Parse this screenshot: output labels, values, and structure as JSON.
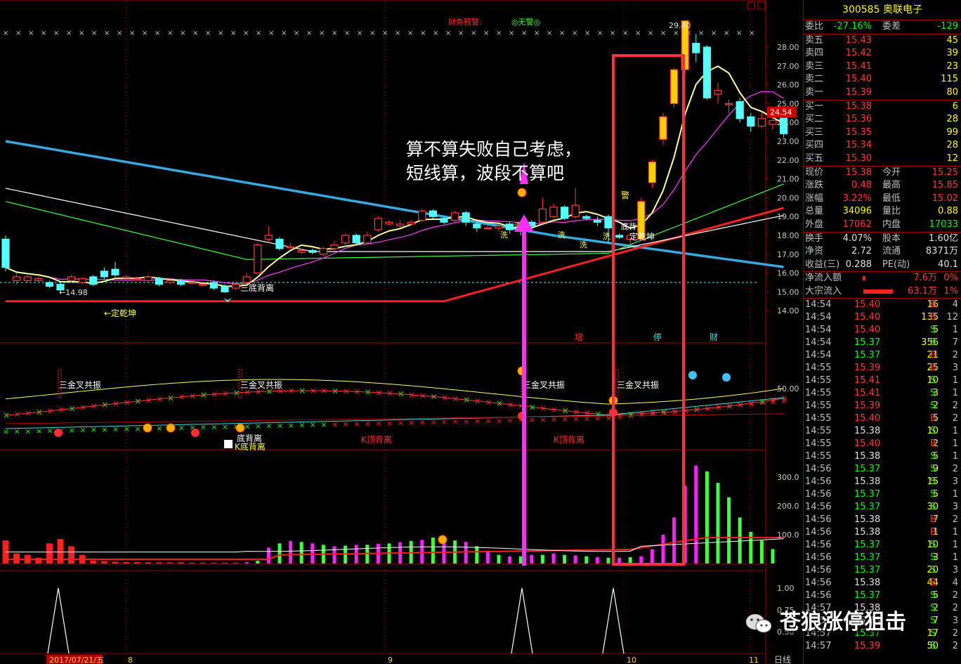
{
  "chart_data": {
    "type": "candlestick",
    "price_axis": {
      "ticks": [
        "28.00",
        "27.00",
        "26.00",
        "25.00",
        "24.00",
        "23.00",
        "22.00",
        "21.00",
        "20.00",
        "19.00",
        "18.00",
        "17.00",
        "16.00",
        "15.00",
        "14.00"
      ],
      "ylim": [
        14,
        29.4
      ]
    },
    "current_price_tag": "24.54",
    "high_label": "29.40",
    "low_label": "←14.98",
    "dashed_level": 15.5,
    "candles": [
      {
        "o": 17.8,
        "c": 16.3,
        "h": 18.0,
        "l": 16.1
      },
      {
        "o": 15.6,
        "c": 15.8,
        "h": 16.0,
        "l": 15.4
      },
      {
        "o": 15.6,
        "c": 15.8,
        "h": 15.9,
        "l": 15.5
      },
      {
        "o": 15.6,
        "c": 15.7,
        "h": 15.8,
        "l": 15.5
      },
      {
        "o": 15.5,
        "c": 15.3,
        "h": 15.6,
        "l": 15.2
      },
      {
        "o": 15.4,
        "c": 15.1,
        "h": 15.5,
        "l": 14.98
      },
      {
        "o": 15.6,
        "c": 15.8,
        "h": 15.9,
        "l": 15.5
      },
      {
        "o": 15.5,
        "c": 15.7,
        "h": 15.8,
        "l": 15.4
      },
      {
        "o": 15.8,
        "c": 15.4,
        "h": 15.9,
        "l": 15.3
      },
      {
        "o": 16.1,
        "c": 15.8,
        "h": 16.3,
        "l": 15.7
      },
      {
        "o": 16.2,
        "c": 15.9,
        "h": 16.6,
        "l": 15.8
      },
      {
        "o": 15.8,
        "c": 15.8,
        "h": 15.9,
        "l": 15.7
      },
      {
        "o": 15.7,
        "c": 15.7,
        "h": 15.8,
        "l": 15.6
      },
      {
        "o": 15.6,
        "c": 15.8,
        "h": 15.9,
        "l": 15.5
      },
      {
        "o": 15.7,
        "c": 15.4,
        "h": 15.8,
        "l": 15.3
      },
      {
        "o": 15.5,
        "c": 15.6,
        "h": 15.7,
        "l": 15.4
      },
      {
        "o": 15.6,
        "c": 15.4,
        "h": 15.7,
        "l": 15.3
      },
      {
        "o": 15.5,
        "c": 15.5,
        "h": 15.6,
        "l": 15.4
      },
      {
        "o": 15.4,
        "c": 15.4,
        "h": 15.5,
        "l": 15.3
      },
      {
        "o": 15.5,
        "c": 15.2,
        "h": 15.6,
        "l": 15.1
      },
      {
        "o": 15.3,
        "c": 15.0,
        "h": 15.4,
        "l": 14.95
      },
      {
        "o": 15.2,
        "c": 15.4,
        "h": 15.5,
        "l": 15.1
      },
      {
        "o": 15.5,
        "c": 15.8,
        "h": 16.0,
        "l": 15.4
      },
      {
        "o": 16.0,
        "c": 17.5,
        "h": 17.6,
        "l": 16.0
      },
      {
        "o": 17.8,
        "c": 18.0,
        "h": 18.5,
        "l": 17.6
      },
      {
        "o": 17.8,
        "c": 17.3,
        "h": 17.9,
        "l": 17.2
      },
      {
        "o": 17.4,
        "c": 17.4,
        "h": 17.6,
        "l": 17.3
      },
      {
        "o": 17.1,
        "c": 17.2,
        "h": 17.3,
        "l": 17.0
      },
      {
        "o": 17.2,
        "c": 17.1,
        "h": 17.3,
        "l": 17.0
      },
      {
        "o": 17.0,
        "c": 17.3,
        "h": 17.4,
        "l": 16.9
      },
      {
        "o": 17.3,
        "c": 17.5,
        "h": 17.7,
        "l": 17.2
      },
      {
        "o": 17.6,
        "c": 18.0,
        "h": 18.1,
        "l": 17.4
      },
      {
        "o": 18.0,
        "c": 17.6,
        "h": 18.1,
        "l": 17.5
      },
      {
        "o": 17.6,
        "c": 18.0,
        "h": 18.2,
        "l": 17.5
      },
      {
        "o": 18.3,
        "c": 18.9,
        "h": 19.0,
        "l": 18.2
      },
      {
        "o": 18.6,
        "c": 18.7,
        "h": 18.8,
        "l": 18.5
      },
      {
        "o": 18.5,
        "c": 18.6,
        "h": 18.8,
        "l": 18.4
      },
      {
        "o": 18.6,
        "c": 18.7,
        "h": 18.8,
        "l": 18.5
      },
      {
        "o": 18.8,
        "c": 19.3,
        "h": 19.4,
        "l": 18.7
      },
      {
        "o": 19.3,
        "c": 19.0,
        "h": 19.4,
        "l": 18.9
      },
      {
        "o": 18.9,
        "c": 18.7,
        "h": 19.0,
        "l": 18.6
      },
      {
        "o": 18.8,
        "c": 19.2,
        "h": 19.3,
        "l": 18.7
      },
      {
        "o": 19.2,
        "c": 18.7,
        "h": 19.3,
        "l": 18.5
      },
      {
        "o": 18.6,
        "c": 18.4,
        "h": 18.7,
        "l": 18.2
      },
      {
        "o": 18.4,
        "c": 18.4,
        "h": 18.5,
        "l": 18.3
      },
      {
        "o": 18.4,
        "c": 18.5,
        "h": 18.6,
        "l": 18.2
      },
      {
        "o": 18.6,
        "c": 18.3,
        "h": 18.7,
        "l": 18.1
      },
      {
        "o": 18.5,
        "c": 18.3,
        "h": 18.6,
        "l": 18.0
      },
      {
        "o": 18.7,
        "c": 18.5,
        "h": 18.8,
        "l": 18.4
      },
      {
        "o": 18.7,
        "c": 19.4,
        "h": 20.0,
        "l": 18.6
      },
      {
        "o": 19.0,
        "c": 19.5,
        "h": 19.7,
        "l": 18.9
      },
      {
        "o": 19.5,
        "c": 18.9,
        "h": 19.6,
        "l": 18.8
      },
      {
        "o": 19.0,
        "c": 19.6,
        "h": 20.5,
        "l": 18.9
      },
      {
        "o": 19.0,
        "c": 18.9,
        "h": 19.1,
        "l": 18.8
      },
      {
        "o": 18.8,
        "c": 18.7,
        "h": 19.0,
        "l": 18.5
      },
      {
        "o": 19.0,
        "c": 18.4,
        "h": 19.1,
        "l": 17.6
      },
      {
        "o": 18.0,
        "c": 17.9,
        "h": 18.1,
        "l": 17.8
      },
      {
        "o": 17.8,
        "c": 18.0,
        "h": 18.1,
        "l": 17.5
      },
      {
        "o": 17.8,
        "c": 19.8,
        "h": 20.0,
        "l": 17.7
      },
      {
        "o": 20.8,
        "c": 21.9,
        "h": 22.0,
        "l": 20.5
      },
      {
        "o": 23.1,
        "c": 24.3,
        "h": 24.5,
        "l": 22.8
      },
      {
        "o": 25.0,
        "c": 26.8,
        "h": 26.9,
        "l": 24.8
      },
      {
        "o": 26.8,
        "c": 29.4,
        "h": 29.4,
        "l": 26.5
      },
      {
        "o": 28.2,
        "c": 27.7,
        "h": 28.7,
        "l": 27.2
      },
      {
        "o": 28.0,
        "c": 25.3,
        "h": 28.1,
        "l": 25.2
      },
      {
        "o": 25.5,
        "c": 25.7,
        "h": 26.1,
        "l": 25.0
      },
      {
        "o": 25.0,
        "c": 25.0,
        "h": 25.2,
        "l": 24.5
      },
      {
        "o": 25.1,
        "c": 24.2,
        "h": 25.3,
        "l": 24.0
      },
      {
        "o": 24.3,
        "c": 23.8,
        "h": 24.5,
        "l": 23.5
      },
      {
        "o": 23.8,
        "c": 24.2,
        "h": 24.5,
        "l": 23.7
      },
      {
        "o": 23.9,
        "c": 24.1,
        "h": 24.4,
        "l": 23.6
      },
      {
        "o": 24.3,
        "c": 23.4,
        "h": 24.8,
        "l": 23.2
      }
    ],
    "indicator_axis": {
      "ticks": [
        "50.00"
      ]
    },
    "volume_axis": {
      "ticks": [
        "300.0",
        "200.0",
        "100.0"
      ],
      "ylim": [
        0,
        380
      ]
    },
    "volumes": [
      80,
      35,
      30,
      20,
      70,
      85,
      60,
      30,
      10,
      8,
      6,
      5,
      5,
      4,
      4,
      4,
      4,
      3,
      3,
      3,
      3,
      3,
      5,
      10,
      55,
      70,
      78,
      75,
      70,
      65,
      60,
      62,
      65,
      65,
      68,
      70,
      74,
      78,
      82,
      90,
      80,
      80,
      75,
      60,
      45,
      30,
      25,
      25,
      30,
      30,
      35,
      30,
      28,
      25,
      22,
      20,
      20,
      22,
      25,
      50,
      100,
      160,
      270,
      340,
      320,
      280,
      230,
      160,
      110,
      80,
      50
    ],
    "signal_axis": {
      "ticks": [
        "1.00",
        "0.75",
        "0.50"
      ]
    },
    "signals_at": [
      5,
      45,
      53
    ],
    "date_axis": {
      "labels": [
        "2017/07/21/五",
        "8",
        "9",
        "10",
        "11"
      ]
    },
    "right_axis_label": "日线"
  },
  "annotations": {
    "main": "算不算失败自己考虑，\n短线算，波段不算吧",
    "fin_warn": "财务预警:",
    "no_warn": "◎无警◎",
    "triple_bottom": "三底背离",
    "dingqiankun_1": "←定乾坤",
    "dingqiankun_2": "定乾坤",
    "zeng": "增",
    "ting": "停",
    "cai": "财",
    "sanjin_1": "三金叉共振",
    "sanjin_2": "三金叉共振",
    "sanjin_3": "三金叉共振",
    "sanjin_4": "三金叉共振",
    "k_bottom": "K底背离",
    "k_top_1": "K顶背离",
    "k_top_2": "K顶背离",
    "bottom_div": "底背离",
    "xi": "洗",
    "jing": "警",
    "di_bei": "底背"
  },
  "quote": {
    "title": "300585 奥联电子",
    "weibi_label": "委比",
    "weibi": "-27.16%",
    "weicha_label": "委差",
    "weicha": "-129",
    "asks": [
      {
        "label": "卖五",
        "price": "15.43",
        "vol": "45"
      },
      {
        "label": "卖四",
        "price": "15.42",
        "vol": "39"
      },
      {
        "label": "卖三",
        "price": "15.41",
        "vol": "23"
      },
      {
        "label": "卖二",
        "price": "15.40",
        "vol": "115"
      },
      {
        "label": "卖一",
        "price": "15.39",
        "vol": "80"
      }
    ],
    "bids": [
      {
        "label": "买一",
        "price": "15.38",
        "vol": "6"
      },
      {
        "label": "买二",
        "price": "15.36",
        "vol": "28"
      },
      {
        "label": "买三",
        "price": "15.35",
        "vol": "99"
      },
      {
        "label": "买四",
        "price": "15.34",
        "vol": "28"
      },
      {
        "label": "买五",
        "price": "15.30",
        "vol": "12"
      }
    ],
    "stats": [
      {
        "l1": "现价",
        "v1": "15.38",
        "c1": "red",
        "l2": "今开",
        "v2": "15.25",
        "c2": "red"
      },
      {
        "l1": "涨跌",
        "v1": "0.48",
        "c1": "red",
        "l2": "最高",
        "v2": "15.85",
        "c2": "red"
      },
      {
        "l1": "涨幅",
        "v1": "3.22%",
        "c1": "red",
        "l2": "最低",
        "v2": "15.02",
        "c2": "red"
      },
      {
        "l1": "总量",
        "v1": "34096",
        "c1": "yel",
        "l2": "量比",
        "v2": "0.88",
        "c2": "yel"
      },
      {
        "l1": "外盘",
        "v1": "17062",
        "c1": "red",
        "l2": "内盘",
        "v2": "17033",
        "c2": "grn"
      }
    ],
    "stats2": [
      {
        "l1": "换手",
        "v1": "4.07%",
        "l2": "股本",
        "v2": "1.60亿"
      },
      {
        "l1": "净资",
        "v1": "2.72",
        "l2": "流通",
        "v2": "8371万"
      },
      {
        "l1": "收益(三)",
        "v1": "0.288",
        "l2": "PE(动)",
        "v2": "40.1"
      }
    ],
    "flow": [
      {
        "label": "净流入额",
        "amount": "7.6万",
        "pct": "0%"
      },
      {
        "label": "大宗流入",
        "amount": "63.1万",
        "pct": "1%"
      }
    ],
    "ticks": [
      {
        "t": "14:54",
        "p": "15.40",
        "v": "16",
        "d": "B",
        "n": "4"
      },
      {
        "t": "14:54",
        "p": "15.40",
        "v": "135",
        "d": "B",
        "n": "12"
      },
      {
        "t": "14:54",
        "p": "15.40",
        "v": "5",
        "d": "S",
        "n": "1"
      },
      {
        "t": "14:54",
        "p": "15.37",
        "v": "356",
        "d": "S",
        "n": "7"
      },
      {
        "t": "14:54",
        "p": "15.37",
        "v": "21",
        "d": "B",
        "n": "2"
      },
      {
        "t": "14:55",
        "p": "15.39",
        "v": "25",
        "d": "B",
        "n": "3"
      },
      {
        "t": "14:55",
        "p": "15.41",
        "v": "10",
        "d": "S",
        "n": "1"
      },
      {
        "t": "14:55",
        "p": "15.41",
        "v": "3",
        "d": "S",
        "n": "1"
      },
      {
        "t": "14:55",
        "p": "15.39",
        "v": "2",
        "d": "S",
        "n": "2"
      },
      {
        "t": "14:55",
        "p": "15.40",
        "v": "5",
        "d": "B",
        "n": "2"
      },
      {
        "t": "14:55",
        "p": "15.38",
        "v": "10",
        "d": "S",
        "n": "1"
      },
      {
        "t": "14:55",
        "p": "15.40",
        "v": "2",
        "d": "B",
        "n": "1"
      },
      {
        "t": "14:55",
        "p": "15.38",
        "v": "5",
        "d": "S",
        "n": "1"
      },
      {
        "t": "14:56",
        "p": "15.37",
        "v": "9",
        "d": "S",
        "n": "2"
      },
      {
        "t": "14:56",
        "p": "15.38",
        "v": "15",
        "d": "S",
        "n": "3"
      },
      {
        "t": "14:56",
        "p": "15.37",
        "v": "5",
        "d": "S",
        "n": "1"
      },
      {
        "t": "14:56",
        "p": "15.37",
        "v": "30",
        "d": "S",
        "n": "3"
      },
      {
        "t": "14:56",
        "p": "15.38",
        "v": "7",
        "d": "B",
        "n": "2"
      },
      {
        "t": "14:56",
        "p": "15.38",
        "v": "1",
        "d": "B",
        "n": "1"
      },
      {
        "t": "14:56",
        "p": "15.37",
        "v": "10",
        "d": "S",
        "n": "1"
      },
      {
        "t": "14:56",
        "p": "15.37",
        "v": "3",
        "d": "S",
        "n": "1"
      },
      {
        "t": "14:56",
        "p": "15.37",
        "v": "20",
        "d": "S",
        "n": "3"
      },
      {
        "t": "14:56",
        "p": "15.38",
        "v": "44",
        "d": "B",
        "n": "4"
      },
      {
        "t": "14:56",
        "p": "15.37",
        "v": "5",
        "d": "S",
        "n": "2"
      },
      {
        "t": "14:57",
        "p": "15.38",
        "v": "2",
        "d": "S",
        "n": "2"
      },
      {
        "t": "14:57",
        "p": "15.38",
        "v": "7",
        "d": "S",
        "n": "3"
      },
      {
        "t": "14:57",
        "p": "15.37",
        "v": "17",
        "d": "S",
        "n": "2"
      },
      {
        "t": "14:57",
        "p": "15.39",
        "v": "50",
        "d": "S",
        "n": "2"
      }
    ]
  },
  "watermark": "苍狼涨停狙击",
  "colors": {
    "up": "#ff3c3c",
    "down": "#54ffff",
    "grid": "#a00000",
    "ma5": "#ffffa0",
    "ma10": "#ff40ff",
    "ma20": "#40ff40",
    "ma60": "#ffffff",
    "ma120": "#3aa8e0",
    "ma250": "#ff2020"
  }
}
